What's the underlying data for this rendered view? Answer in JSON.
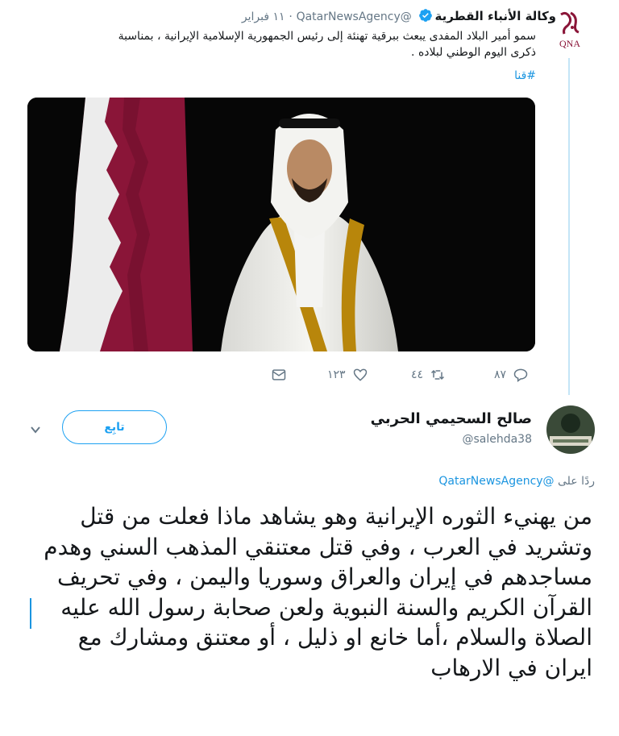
{
  "quoted_tweet": {
    "author_name": "وكالة الأنباء القطرية",
    "handle": "@QatarNewsAgency",
    "separator": "·",
    "date": "١١ فبراير",
    "avatar_logo_text": "QNA",
    "text": "سمو أمير البلاد المفدى يبعث ببرقية تهنئة إلى رئيس الجمهورية الإسلامية الإيرانية ، بمناسبة ذكرى اليوم الوطني لبلاده .",
    "hashtag": "#قنا",
    "actions": {
      "reply_count": "٨٧",
      "retweet_count": "٤٤",
      "like_count": "١٢٣",
      "message_count": ""
    }
  },
  "reply_tweet": {
    "author_name": "صالح السحيمي الحربي",
    "handle": "@salehda38",
    "follow_label": "تابِع",
    "replying_prefix": "ردًا على",
    "replying_handle": "@QatarNewsAgency",
    "text": "من يهنيء الثوره الإيرانية وهو يشاهد ماذا فعلت من قتل وتشريد في العرب ، وفي قتل معتنقي المذهب السني وهدم مساجدهم في إيران والعراق وسوريا واليمن ، وفي تحريف القرآن الكريم والسنة النبوية ولعن صحابة رسول الله عليه الصلاة والسلام ،أما خانع او ذليل ، أو معتنق ومشارك مع ايران في الارهاب"
  },
  "colors": {
    "accent": "#1da1f2",
    "link": "#1b95e0",
    "muted": "#657786",
    "flag_maroon": "#8a1538",
    "thread_line": "#c4e5f7"
  }
}
